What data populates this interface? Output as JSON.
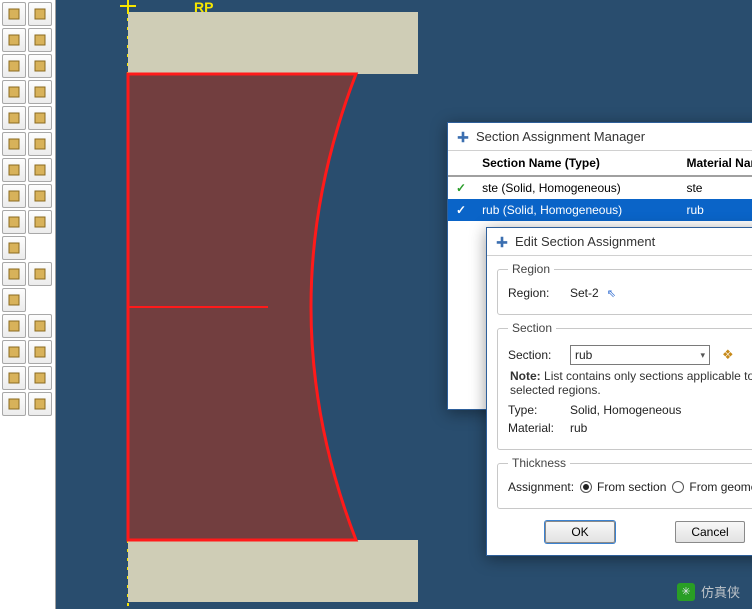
{
  "rp_label": "RP",
  "manager": {
    "title": "Section Assignment Manager",
    "columns": [
      "Section Name (Type)",
      "Material Name"
    ],
    "rows": [
      {
        "check": "✓",
        "name": "ste (Solid, Homogeneous)",
        "material": "ste",
        "selected": false
      },
      {
        "check": "✓",
        "name": "rub (Solid, Homogeneous)",
        "material": "rub",
        "selected": true
      }
    ]
  },
  "edit": {
    "title": "Edit Section Assignment",
    "region_legend": "Region",
    "region_label": "Region:",
    "region_value": "Set-2",
    "section_legend": "Section",
    "section_label": "Section:",
    "section_value": "rub",
    "note_label": "Note:",
    "note_text": "List contains only sections applicable to the selected regions.",
    "type_label": "Type:",
    "type_value": "Solid, Homogeneous",
    "material_label": "Material:",
    "material_value": "rub",
    "thickness_legend": "Thickness",
    "assignment_label": "Assignment:",
    "radio_from_section": "From section",
    "radio_from_geometry": "From geometry",
    "ok": "OK",
    "cancel": "Cancel"
  },
  "watermark": "仿真侠",
  "toolbox_icons": [
    [
      "part-create",
      "property"
    ],
    [
      "beam",
      "list"
    ],
    [
      "beam2",
      "list2"
    ],
    [
      "stack",
      "sigma"
    ],
    [
      "extrude",
      "frac"
    ],
    [
      "orient",
      "list3"
    ],
    [
      "cube",
      "list4"
    ],
    [
      "shell",
      "list5"
    ],
    [
      "part-a",
      "part-b"
    ],
    [
      "edit",
      ""
    ],
    [
      "plus",
      "measure"
    ],
    [
      "grid",
      ""
    ],
    [
      "pick",
      "origin"
    ],
    [
      "origin2",
      "corner"
    ],
    [
      "xyz",
      "axis"
    ],
    [
      "face",
      "tri"
    ]
  ]
}
